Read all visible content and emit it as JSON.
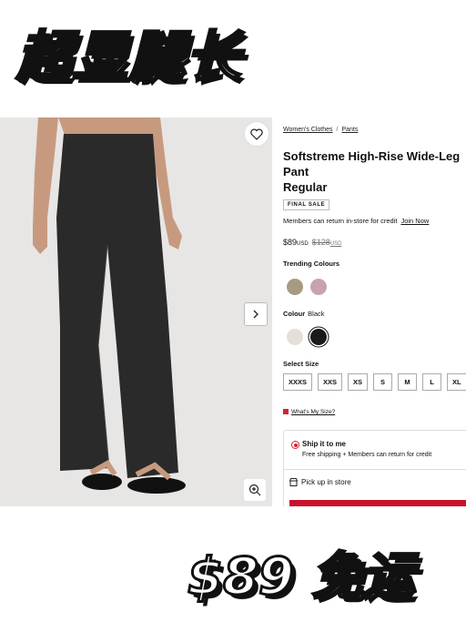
{
  "banner": {
    "top_text": "超显腿长",
    "bottom_text": "$89 免运"
  },
  "breadcrumb": {
    "items": [
      "Women's Clothes",
      "Pants"
    ],
    "separator": "/"
  },
  "product": {
    "title": "Softstreme High-Rise Wide-Leg Pant",
    "fit": "Regular",
    "badge": "FINAL SALE",
    "members_note": "Members can return in-store for credit",
    "join_link": "Join Now",
    "price": "$89",
    "currency": "USD",
    "was_price": "$128",
    "was_currency": "USD"
  },
  "trending": {
    "label": "Trending Colours",
    "swatches": [
      "#a89a82",
      "#c9a3ab"
    ]
  },
  "colour": {
    "label": "Colour",
    "selected": "Black",
    "swatches": [
      "#e4e0d8",
      "#1a1a1a"
    ]
  },
  "size": {
    "label": "Select Size",
    "options": [
      "XXXS",
      "XXS",
      "XS",
      "S",
      "M",
      "L",
      "XL"
    ],
    "guide_link": "What's My Size?"
  },
  "delivery": {
    "ship_title": "Ship it to me",
    "ship_sub": "Free shipping + Members can return for credit",
    "pickup": "Pick up in store"
  },
  "colors": {
    "accent": "#d22630",
    "photo_bg": "#e7e6e4",
    "pants": "#2a2a2a",
    "skin": "#c79a80"
  }
}
